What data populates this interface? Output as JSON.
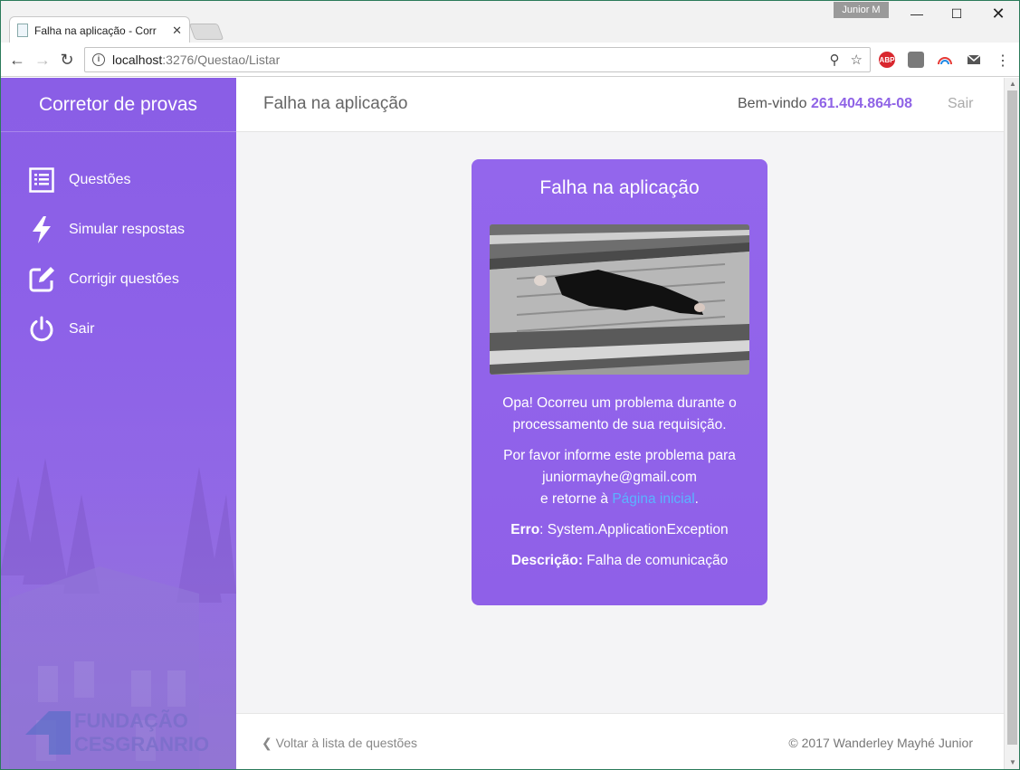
{
  "browser": {
    "profile": "Junior M",
    "tab_title": "Falha na aplicação - Corr",
    "url_host": "localhost",
    "url_path": ":3276/Questao/Listar",
    "ext_abp": "ABP"
  },
  "sidebar": {
    "brand": "Corretor de provas",
    "items": [
      {
        "label": "Questões",
        "icon": "list-icon"
      },
      {
        "label": "Simular respostas",
        "icon": "lightning-icon"
      },
      {
        "label": "Corrigir questões",
        "icon": "edit-icon"
      },
      {
        "label": "Sair",
        "icon": "power-icon"
      }
    ],
    "logo_line1": "FUNDAÇÃO",
    "logo_line2": "CESGRANRIO"
  },
  "header": {
    "title": "Falha na aplicação",
    "welcome_prefix": "Bem-vindo",
    "user": "261.404.864-08",
    "logout": "Sair"
  },
  "error_card": {
    "title": "Falha na aplicação",
    "message": "Opa! Ocorreu um problema durante o processamento de sua requisição.",
    "report_prefix": "Por favor informe este problema para",
    "email": "juniormayhe@gmail.com",
    "return_prefix": "e retorne à",
    "home_link": "Página inicial",
    "error_label": "Erro",
    "error_value": "System.ApplicationException",
    "desc_label": "Descrição:",
    "desc_value": "Falha de comunicação"
  },
  "footer": {
    "back": "Voltar à lista de questões",
    "copyright": "© 2017 Wanderley Mayhé Junior"
  },
  "colors": {
    "accent": "#8f63e6",
    "link": "#5ab4ff"
  }
}
